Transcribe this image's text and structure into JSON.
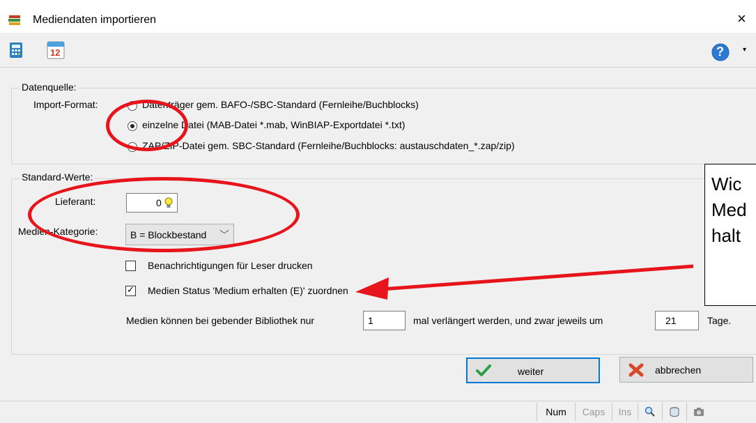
{
  "window": {
    "title": "Mediendaten importieren",
    "close_glyph": "×",
    "icon": "stacked-books-icon"
  },
  "toolbar": {
    "icons": [
      "calculator-icon",
      "calendar-icon"
    ],
    "calendar_day": "12",
    "help_icon": "help-icon",
    "help_glyph": "?",
    "dropdown_glyph": "▾"
  },
  "datenquelle": {
    "legend": "Datenquelle:",
    "import_format_label": "Import-Format:",
    "options": [
      "Datenträger gem. BAFO-/SBC-Standard (Fernleihe/Buchblocks)",
      "einzelne Datei (MAB-Datei *.mab, WinBIAP-Exportdatei *.txt)",
      "ZAP/ZIP-Datei gem. SBC-Standard (Fernleihe/Buchblocks: austauschdaten_*.zap/zip)"
    ],
    "selected_index": 1
  },
  "standard_werte": {
    "legend": "Standard-Werte:",
    "lieferant_label": "Lieferant:",
    "lieferant_value": "0",
    "medien_kategorie_label": "Medien-Kategorie:",
    "medien_kategorie_value": "B = Blockbestand",
    "checkbox_benachrichtigung": {
      "label": "Benachrichtigungen für Leser drucken",
      "checked": false
    },
    "checkbox_status": {
      "label": "Medien Status 'Medium erhalten (E)' zuordnen",
      "checked": true
    },
    "verlaengerung": {
      "text_before": "Medien können bei gebender Bibliothek nur",
      "count_value": "1",
      "text_middle": "mal verlängert werden, und zwar jeweils um",
      "days_value": "21",
      "text_after": "Tage."
    }
  },
  "buttons": {
    "weiter": "weiter",
    "abbrechen": "abbrechen"
  },
  "statusbar": {
    "num": "Num",
    "caps": "Caps",
    "ins": "Ins",
    "icons": [
      "magnifier-icon",
      "database-icon",
      "camera-icon"
    ]
  },
  "annotation": {
    "lines": [
      "Wic",
      "Med",
      "halt"
    ],
    "colors": {
      "mark": "#e8141b"
    }
  }
}
